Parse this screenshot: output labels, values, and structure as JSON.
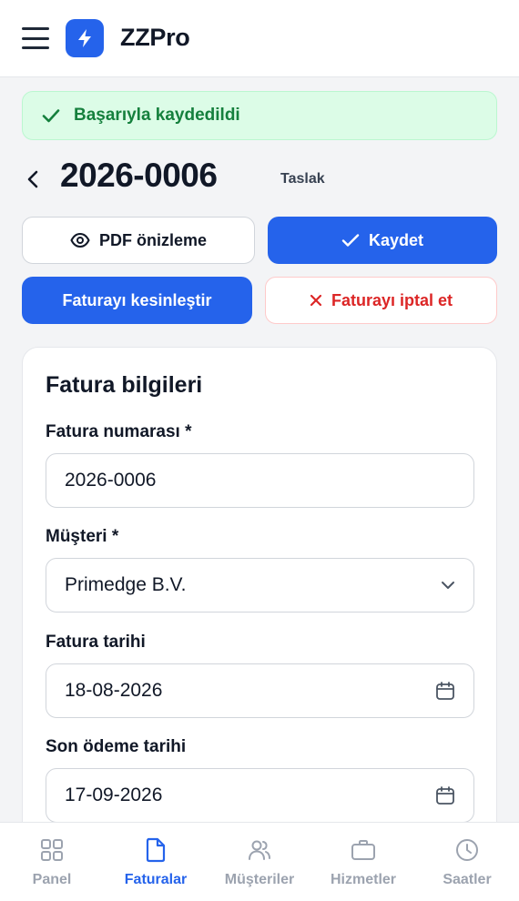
{
  "header": {
    "brand": "ZZPro",
    "menu_icon": "hamburger-menu-icon",
    "logo_icon": "lightning-bolt-icon"
  },
  "alert": {
    "text": "Başarıyla kaydedildi",
    "icon": "check-icon"
  },
  "invoice": {
    "number_title": "2026-0006",
    "status": "Taslak"
  },
  "actions": {
    "preview_label": "PDF önizleme",
    "save_label": "Kaydet",
    "finalize_label": "Faturayı kesinleştir",
    "cancel_label": "Faturayı iptal et"
  },
  "form": {
    "title": "Fatura bilgileri",
    "invoice_number": {
      "label": "Fatura numarası *",
      "value": "2026-0006"
    },
    "customer": {
      "label": "Müşteri *",
      "value": "Primedge B.V."
    },
    "invoice_date": {
      "label": "Fatura tarihi",
      "value": "18-08-2026"
    },
    "due_date": {
      "label": "Son ödeme tarihi",
      "value": "17-09-2026"
    }
  },
  "bottom_nav": {
    "items": [
      {
        "label": "Panel",
        "icon": "grid-icon",
        "active": false
      },
      {
        "label": "Faturalar",
        "icon": "document-icon",
        "active": true
      },
      {
        "label": "Müşteriler",
        "icon": "users-icon",
        "active": false
      },
      {
        "label": "Hizmetler",
        "icon": "briefcase-icon",
        "active": false
      },
      {
        "label": "Saatler",
        "icon": "clock-icon",
        "active": false
      }
    ]
  },
  "colors": {
    "primary": "#2563eb",
    "success_bg": "#dcfce7",
    "success_text": "#15803d",
    "danger": "#dc2626",
    "inactive_nav": "#9ca3af"
  }
}
